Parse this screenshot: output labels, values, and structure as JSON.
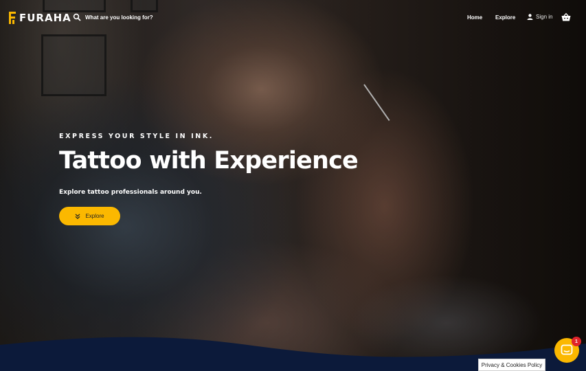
{
  "brand": {
    "name": "FURAHA",
    "logo_letter": "F",
    "accent_color": "#fbb800"
  },
  "search": {
    "placeholder": "What are you looking for?",
    "icon": "search-icon"
  },
  "nav": {
    "items": [
      {
        "label": "Home"
      },
      {
        "label": "Explore"
      }
    ],
    "signin_label": "Sign in",
    "signin_icon": "user-icon",
    "basket_icon": "basket-icon"
  },
  "hero": {
    "eyebrow": "EXPRESS YOUR STYLE IN INK.",
    "headline": "Tattoo with Experience",
    "subline": "Explore tattoo professionals around you.",
    "button_label": "Explore",
    "button_icon": "double-chevron-down-icon"
  },
  "footer": {
    "privacy_label": "Privacy & Cookies Policy",
    "wave_color": "#0c1a3a"
  },
  "chat": {
    "icon": "chat-icon",
    "badge_count": "1"
  }
}
